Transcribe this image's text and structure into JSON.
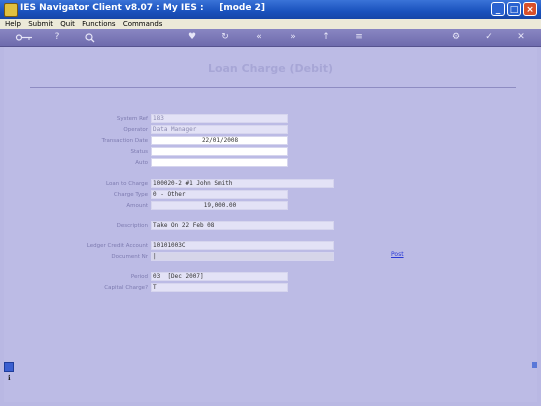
{
  "window": {
    "title": "IES Navigator Client v8.07 : My IES :     [mode 2]"
  },
  "menu": [
    "Help",
    "Submit",
    "Quit",
    "Functions",
    "Commands"
  ],
  "toolbar_icons": [
    "key-icon",
    "help-icon",
    "search-icon",
    "heart-icon",
    "refresh-icon",
    "back-icon",
    "forward-icon",
    "upload-icon",
    "menu-icon",
    "settings-icon",
    "ok-icon",
    "close-icon"
  ],
  "form": {
    "title": "Loan Charge (Debit)",
    "fields": {
      "system_ref": {
        "label": "System Ref",
        "value": "183"
      },
      "operator": {
        "label": "Operator",
        "value": "Data Manager"
      },
      "trans_date": {
        "label": "Transaction Date",
        "value": "22/01/2008"
      },
      "status": {
        "label": "Status",
        "value": ""
      },
      "auto": {
        "label": "Auto",
        "value": ""
      },
      "loan": {
        "label": "Loan to Charge",
        "value": "100020-2 #1 John Smith"
      },
      "charge_type": {
        "label": "Charge Type",
        "value": "0 - Other"
      },
      "amount": {
        "label": "Amount",
        "value": "19,000.00"
      },
      "description": {
        "label": "Description",
        "value": "Take On 22 Feb 08"
      },
      "ledger": {
        "label": "Ledger Credit Account",
        "value": "10101003C"
      },
      "document": {
        "label": "Document Nr",
        "value": "|"
      },
      "period": {
        "label": "Period",
        "value": "03  [Dec 2007]"
      },
      "capital": {
        "label": "Capital Charge?",
        "value": "T"
      }
    },
    "post_label": "Post"
  }
}
